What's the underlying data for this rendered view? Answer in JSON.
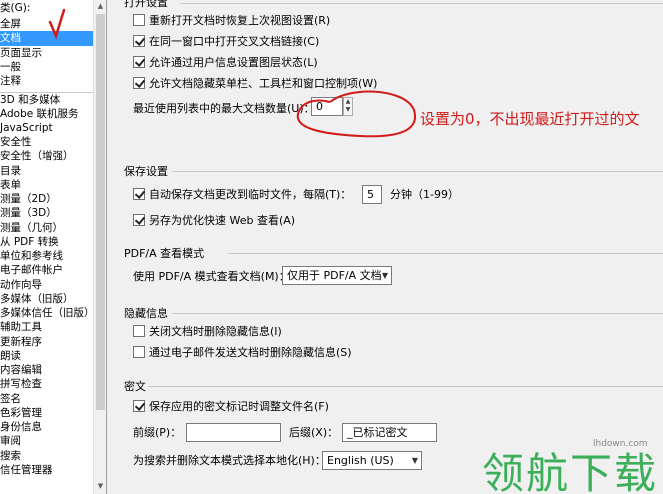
{
  "categories": {
    "header": "类(G):",
    "items": [
      {
        "label": "全屏",
        "selected": false
      },
      {
        "label": "文档",
        "selected": true
      },
      {
        "label": "页面显示",
        "selected": false
      },
      {
        "label": "一般",
        "selected": false
      },
      {
        "label": "注释",
        "selected": false
      },
      {
        "label": "3D 和多媒体",
        "selected": false,
        "separator": true
      },
      {
        "label": "Adobe 联机服务",
        "selected": false
      },
      {
        "label": "JavaScript",
        "selected": false
      },
      {
        "label": "安全性",
        "selected": false
      },
      {
        "label": "安全性（增强）",
        "selected": false
      },
      {
        "label": "目录",
        "selected": false
      },
      {
        "label": "表单",
        "selected": false
      },
      {
        "label": "测量（2D）",
        "selected": false
      },
      {
        "label": "测量（3D）",
        "selected": false
      },
      {
        "label": "测量（几何）",
        "selected": false
      },
      {
        "label": "从 PDF 转换",
        "selected": false
      },
      {
        "label": "单位和参考线",
        "selected": false
      },
      {
        "label": "电子邮件帐户",
        "selected": false
      },
      {
        "label": "动作向导",
        "selected": false
      },
      {
        "label": "多媒体（旧版）",
        "selected": false
      },
      {
        "label": "多媒体信任（旧版）",
        "selected": false
      },
      {
        "label": "辅助工具",
        "selected": false
      },
      {
        "label": "更新程序",
        "selected": false
      },
      {
        "label": "朗读",
        "selected": false
      },
      {
        "label": "内容编辑",
        "selected": false
      },
      {
        "label": "拼写检查",
        "selected": false
      },
      {
        "label": "签名",
        "selected": false
      },
      {
        "label": "色彩管理",
        "selected": false
      },
      {
        "label": "身份信息",
        "selected": false
      },
      {
        "label": "审阅",
        "selected": false
      },
      {
        "label": "搜索",
        "selected": false
      },
      {
        "label": "信任管理器",
        "selected": false
      }
    ]
  },
  "open_settings": {
    "title": "打开设置",
    "options": [
      {
        "label": "重新打开文档时恢复上次视图设置(R)",
        "checked": false
      },
      {
        "label": "在同一窗口中打开交叉文档链接(C)",
        "checked": true
      },
      {
        "label": "允许通过用户信息设置图层状态(L)",
        "checked": true
      },
      {
        "label": "允许文档隐藏菜单栏、工具栏和窗口控制项(W)",
        "checked": true
      }
    ],
    "recent_label": "最近使用列表中的最大文档数量(U)：",
    "recent_value": "0"
  },
  "annotation_text": "设置为0，不出现最近打开过的文",
  "save_settings": {
    "title": "保存设置",
    "autosave_label": "自动保存文档更改到临时文件，每隔(T)：",
    "autosave_checked": true,
    "autosave_minutes": "5",
    "minutes_unit": "分钟（1-99）",
    "optimize_label": "另存为优化快速 Web 查看(A)",
    "optimize_checked": true
  },
  "pdfa": {
    "title": "PDF/A 查看模式",
    "mode_label": "使用 PDF/A 模式查看文档(M)：",
    "mode_value": "仅用于 PDF/A 文档"
  },
  "hidden_info": {
    "title": "隐藏信息",
    "options": [
      {
        "label": "关闭文档时删除隐藏信息(I)",
        "checked": false
      },
      {
        "label": "通过电子邮件发送文档时删除隐藏信息(S)",
        "checked": false
      }
    ]
  },
  "redaction": {
    "title": "密文",
    "adjust_label": "保存应用的密文标记时调整文件名(F)",
    "adjust_checked": true,
    "prefix_label": "前缀(P)：",
    "prefix_value": "",
    "suffix_label": "后缀(X)：",
    "suffix_value": "_已标记密文",
    "search_label": "为搜索并删除文本模式选择本地化(H)：",
    "search_value": "English (US)"
  },
  "watermark": {
    "text": "领航下载",
    "url": "lhdown.com"
  },
  "colors": {
    "selection": "#3399ff",
    "annotation": "#d11a1a",
    "watermark": "#2aa84a"
  }
}
